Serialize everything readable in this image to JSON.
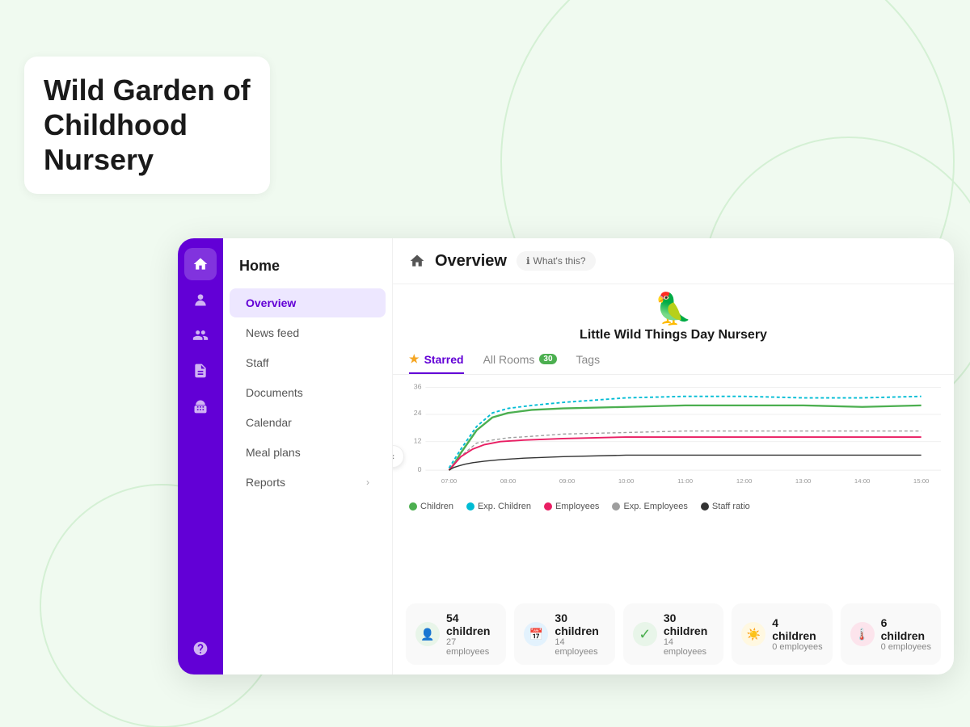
{
  "page": {
    "title_line1": "Wild Garden of",
    "title_line2": "Childhood",
    "title_line3": "Nursery"
  },
  "sidebar": {
    "header": "Home",
    "items": [
      {
        "id": "overview",
        "label": "Overview",
        "active": true,
        "chevron": false
      },
      {
        "id": "newsfeed",
        "label": "News feed",
        "active": false,
        "chevron": false
      },
      {
        "id": "staff",
        "label": "Staff",
        "active": false,
        "chevron": false
      },
      {
        "id": "documents",
        "label": "Documents",
        "active": false,
        "chevron": false
      },
      {
        "id": "calendar",
        "label": "Calendar",
        "active": false,
        "chevron": false
      },
      {
        "id": "mealplans",
        "label": "Meal plans",
        "active": false,
        "chevron": false
      },
      {
        "id": "reports",
        "label": "Reports",
        "active": false,
        "chevron": true
      }
    ]
  },
  "content": {
    "header_title": "Overview",
    "whats_this": "What's this?",
    "mascot_emoji": "🦜",
    "nursery_name": "Little Wild Things Day Nursery"
  },
  "tabs": [
    {
      "id": "starred",
      "label": "Starred",
      "active": true,
      "star": true,
      "badge": null
    },
    {
      "id": "allrooms",
      "label": "All Rooms",
      "active": false,
      "badge": "30"
    },
    {
      "id": "tags",
      "label": "Tags",
      "active": false,
      "badge": null
    }
  ],
  "chart": {
    "y_labels": [
      "0",
      "12",
      "24",
      "36"
    ],
    "x_labels": [
      "07:00",
      "08:00",
      "09:00",
      "10:00",
      "11:00",
      "12:00",
      "13:00",
      "14:00",
      "15:00"
    ],
    "colors": {
      "children": "#4caf50",
      "exp_children": "#00bcd4",
      "employees": "#e91e63",
      "exp_employees": "#9e9e9e",
      "staff_ratio": "#1a1a1a"
    }
  },
  "legend": [
    {
      "label": "Children",
      "color": "#4caf50"
    },
    {
      "label": "Exp. Children",
      "color": "#00bcd4"
    },
    {
      "label": "Employees",
      "color": "#e91e63"
    },
    {
      "label": "Exp. Employees",
      "color": "#9e9e9e"
    },
    {
      "label": "Staff ratio",
      "color": "#333"
    }
  ],
  "stats": [
    {
      "id": "total",
      "count": "54 children",
      "sub": "27 employees",
      "icon": "👤",
      "icon_bg": "#e8f5e9"
    },
    {
      "id": "calendar",
      "count": "30 children",
      "sub": "14 employees",
      "icon": "📅",
      "icon_bg": "#e3f2fd"
    },
    {
      "id": "check",
      "count": "30 children",
      "sub": "14 employees",
      "icon": "✓",
      "icon_bg": "#e8f5e9"
    },
    {
      "id": "sunny",
      "count": "4 children",
      "sub": "0 employees",
      "icon": "☀️",
      "icon_bg": "#fff8e1"
    },
    {
      "id": "temp",
      "count": "6 children",
      "sub": "0 employees",
      "icon": "🌡️",
      "icon_bg": "#fce4ec"
    }
  ]
}
